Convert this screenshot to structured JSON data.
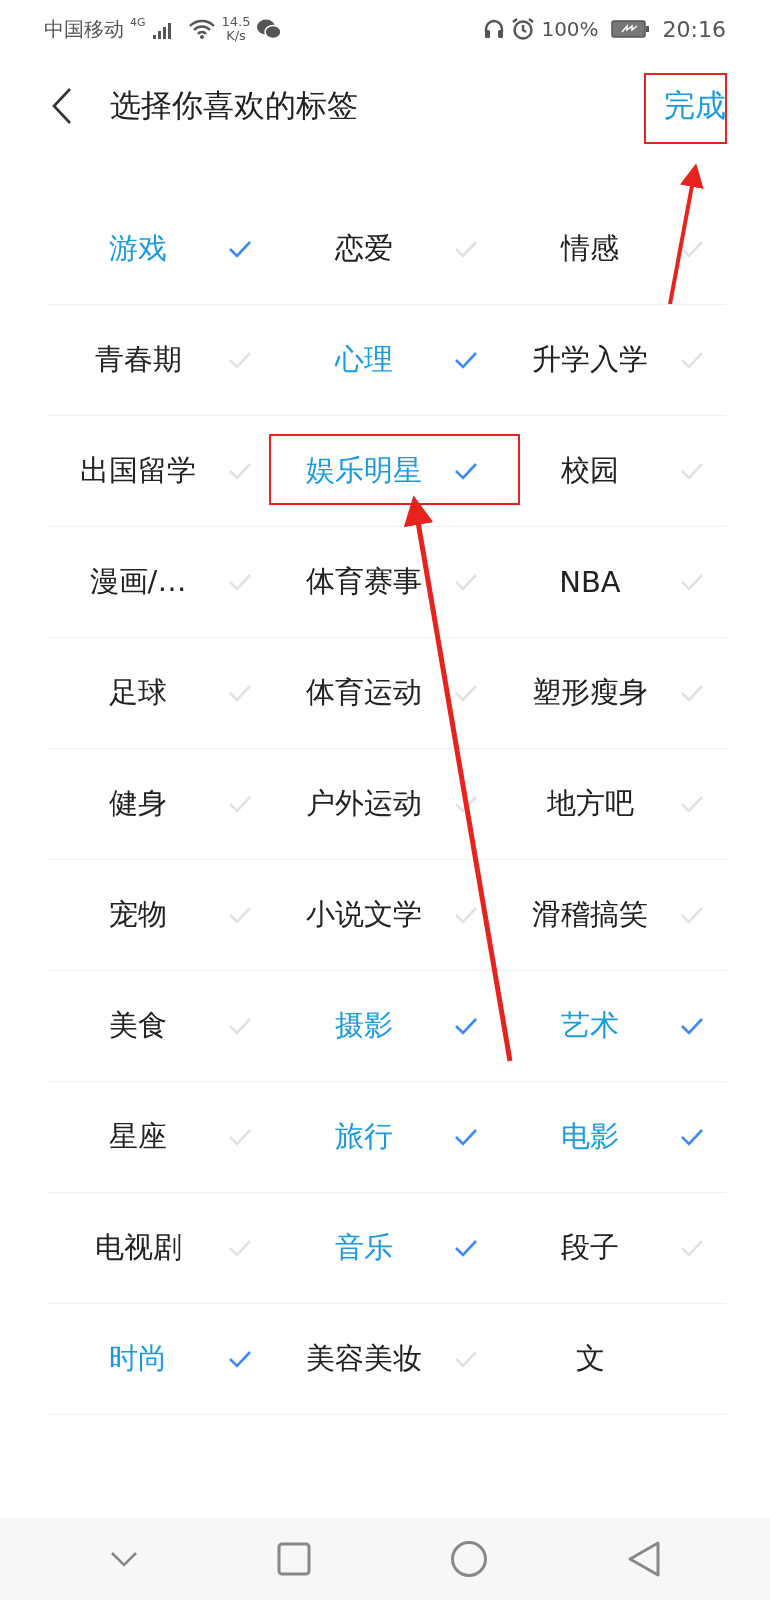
{
  "status_bar": {
    "carrier": "中国移动",
    "network": "4G",
    "speed_value": "14.5",
    "speed_unit": "K/s",
    "battery": "100%",
    "time": "20:16"
  },
  "header": {
    "title": "选择你喜欢的标签",
    "done": "完成"
  },
  "tags": [
    {
      "label": "游戏",
      "selected": true
    },
    {
      "label": "恋爱",
      "selected": false
    },
    {
      "label": "情感",
      "selected": false
    },
    {
      "label": "青春期",
      "selected": false
    },
    {
      "label": "心理",
      "selected": true
    },
    {
      "label": "升学入学",
      "selected": false
    },
    {
      "label": "出国留学",
      "selected": false
    },
    {
      "label": "娱乐明星",
      "selected": true
    },
    {
      "label": "校园",
      "selected": false
    },
    {
      "label": "漫画/…",
      "selected": false
    },
    {
      "label": "体育赛事",
      "selected": false
    },
    {
      "label": "NBA",
      "selected": false
    },
    {
      "label": "足球",
      "selected": false
    },
    {
      "label": "体育运动",
      "selected": false
    },
    {
      "label": "塑形瘦身",
      "selected": false
    },
    {
      "label": "健身",
      "selected": false
    },
    {
      "label": "户外运动",
      "selected": false
    },
    {
      "label": "地方吧",
      "selected": false
    },
    {
      "label": "宠物",
      "selected": false
    },
    {
      "label": "小说文学",
      "selected": false
    },
    {
      "label": "滑稽搞笑",
      "selected": false
    },
    {
      "label": "美食",
      "selected": false
    },
    {
      "label": "摄影",
      "selected": true
    },
    {
      "label": "艺术",
      "selected": true
    },
    {
      "label": "星座",
      "selected": false
    },
    {
      "label": "旅行",
      "selected": true
    },
    {
      "label": "电影",
      "selected": true
    },
    {
      "label": "电视剧",
      "selected": false
    },
    {
      "label": "音乐",
      "selected": true
    },
    {
      "label": "段子",
      "selected": false
    },
    {
      "label": "时尚",
      "selected": true
    },
    {
      "label": "美容美妆",
      "selected": false
    },
    {
      "label": "文",
      "kind": "partial",
      "selected": false
    }
  ]
}
